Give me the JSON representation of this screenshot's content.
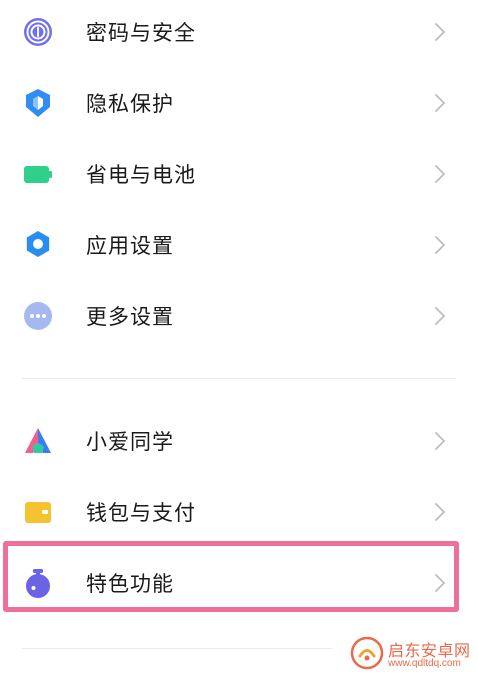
{
  "settings": {
    "items": [
      {
        "label": "密码与安全",
        "icon": "fingerprint-icon",
        "color": "#6f6ff3"
      },
      {
        "label": "隐私保护",
        "icon": "privacy-shield-icon",
        "color": "#2f8df3"
      },
      {
        "label": "省电与电池",
        "icon": "battery-icon",
        "color": "#2fd08a"
      },
      {
        "label": "应用设置",
        "icon": "gear-icon",
        "color": "#2a8df0"
      },
      {
        "label": "更多设置",
        "icon": "more-dots-icon",
        "color": "#a5b8ef"
      },
      {
        "label": "小爱同学",
        "icon": "xiaoai-assistant-icon",
        "color": "#3a7cf5"
      },
      {
        "label": "钱包与支付",
        "icon": "wallet-icon",
        "color": "#f6c330"
      },
      {
        "label": "特色功能",
        "icon": "special-features-icon",
        "color": "#6a63e6"
      }
    ]
  },
  "highlight": {
    "color": "#ee6f97"
  },
  "watermark": {
    "name": "启东安卓网",
    "url": "www.qdltdq.com",
    "color": "#e96a4a"
  }
}
